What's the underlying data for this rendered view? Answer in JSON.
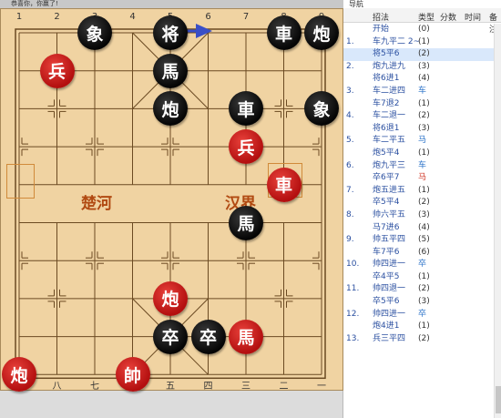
{
  "status_bar": {
    "text": "恭喜你，你赢了!"
  },
  "board": {
    "file_numbers_top": [
      "1",
      "2",
      "3",
      "4",
      "5",
      "6",
      "7",
      "8",
      "9"
    ],
    "file_numbers_bottom": [
      "九",
      "八",
      "七",
      "六",
      "五",
      "四",
      "三",
      "二",
      "一"
    ],
    "river_left": "楚河",
    "river_right": "汉界",
    "pieces": [
      {
        "side": "black",
        "char": "象",
        "file": 2,
        "rank": 0
      },
      {
        "side": "black",
        "char": "将",
        "file": 4,
        "rank": 0
      },
      {
        "side": "black",
        "char": "車",
        "file": 7,
        "rank": 0
      },
      {
        "side": "black",
        "char": "炮",
        "file": 8,
        "rank": 0
      },
      {
        "side": "red",
        "char": "兵",
        "file": 1,
        "rank": 1
      },
      {
        "side": "black",
        "char": "馬",
        "file": 4,
        "rank": 1
      },
      {
        "side": "black",
        "char": "炮",
        "file": 4,
        "rank": 2
      },
      {
        "side": "black",
        "char": "車",
        "file": 6,
        "rank": 2
      },
      {
        "side": "black",
        "char": "象",
        "file": 8,
        "rank": 2
      },
      {
        "side": "red",
        "char": "兵",
        "file": 6,
        "rank": 3
      },
      {
        "side": "red",
        "char": "車",
        "file": 7,
        "rank": 4
      },
      {
        "side": "black",
        "char": "馬",
        "file": 6,
        "rank": 5
      },
      {
        "side": "red",
        "char": "炮",
        "file": 4,
        "rank": 7
      },
      {
        "side": "black",
        "char": "卒",
        "file": 4,
        "rank": 8
      },
      {
        "side": "black",
        "char": "卒",
        "file": 5,
        "rank": 8
      },
      {
        "side": "red",
        "char": "馬",
        "file": 6,
        "rank": 8
      },
      {
        "side": "red",
        "char": "炮",
        "file": 0,
        "rank": 9
      },
      {
        "side": "red",
        "char": "帥",
        "file": 3,
        "rank": 9
      }
    ]
  },
  "navigator": {
    "title": "导航",
    "headers": {
      "moves": "招法",
      "type": "类型",
      "score": "分数",
      "time": "时间",
      "remark": "备注"
    },
    "rows": [
      {
        "num": "",
        "move": "开始",
        "type": "(0)",
        "type_color": "plain"
      },
      {
        "num": "1.",
        "move": "车九平二 2~",
        "type": "(1)",
        "type_color": "plain"
      },
      {
        "num": "",
        "move": "将5平6",
        "type": "(2)",
        "type_color": "plain",
        "selected": true
      },
      {
        "num": "2.",
        "move": "炮九进九",
        "type": "(3)",
        "type_color": "plain"
      },
      {
        "num": "",
        "move": "将6进1",
        "type": "(4)",
        "type_color": "plain"
      },
      {
        "num": "3.",
        "move": "车二进四",
        "type": "车",
        "type_color": "blue"
      },
      {
        "num": "",
        "move": "车7退2",
        "type": "(1)",
        "type_color": "plain"
      },
      {
        "num": "4.",
        "move": "车二退一",
        "type": "(2)",
        "type_color": "plain"
      },
      {
        "num": "",
        "move": "将6退1",
        "type": "(3)",
        "type_color": "plain"
      },
      {
        "num": "5.",
        "move": "车二平五",
        "type": "马",
        "type_color": "blue"
      },
      {
        "num": "",
        "move": "炮5平4",
        "type": "(1)",
        "type_color": "plain"
      },
      {
        "num": "6.",
        "move": "炮九平三",
        "type": "车",
        "type_color": "blue"
      },
      {
        "num": "",
        "move": "卒6平7",
        "type": "马",
        "type_color": "red"
      },
      {
        "num": "7.",
        "move": "炮五进五",
        "type": "(1)",
        "type_color": "plain"
      },
      {
        "num": "",
        "move": "卒5平4",
        "type": "(2)",
        "type_color": "plain"
      },
      {
        "num": "8.",
        "move": "帅六平五",
        "type": "(3)",
        "type_color": "plain"
      },
      {
        "num": "",
        "move": "马7进6",
        "type": "(4)",
        "type_color": "plain"
      },
      {
        "num": "9.",
        "move": "帅五平四",
        "type": "(5)",
        "type_color": "plain"
      },
      {
        "num": "",
        "move": "车7平6",
        "type": "(6)",
        "type_color": "plain"
      },
      {
        "num": "10.",
        "move": "帅四进一",
        "type": "卒",
        "type_color": "blue"
      },
      {
        "num": "",
        "move": "卒4平5",
        "type": "(1)",
        "type_color": "plain"
      },
      {
        "num": "11.",
        "move": "帅四退一",
        "type": "(2)",
        "type_color": "plain"
      },
      {
        "num": "",
        "move": "卒5平6",
        "type": "(3)",
        "type_color": "plain"
      },
      {
        "num": "12.",
        "move": "帅四进一",
        "type": "卒",
        "type_color": "blue"
      },
      {
        "num": "",
        "move": "炮4进1",
        "type": "(1)",
        "type_color": "plain"
      },
      {
        "num": "13.",
        "move": "兵三平四",
        "type": "(2)",
        "type_color": "plain"
      }
    ]
  },
  "colors": {
    "board_bg": "#f0d3a2",
    "line": "#6b4a22",
    "red_piece": "#c8161a",
    "black_piece": "#111111",
    "highlight": "#d9e8fb"
  }
}
